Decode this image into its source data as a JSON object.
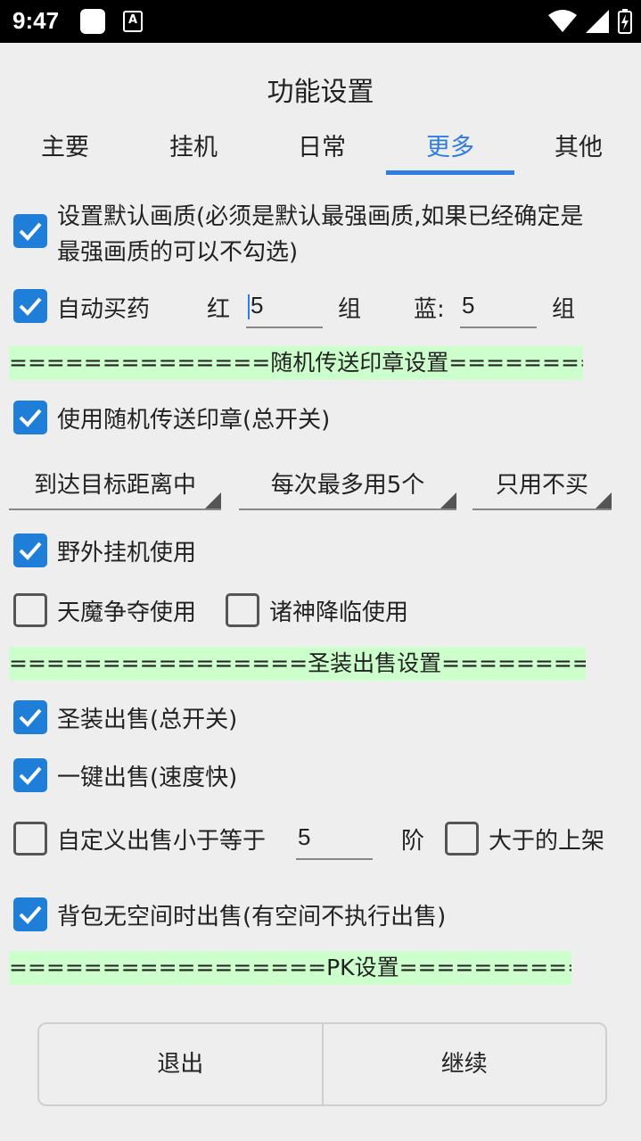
{
  "status_bar": {
    "time": "9:47"
  },
  "title": "功能设置",
  "tabs": [
    {
      "label": "主要"
    },
    {
      "label": "挂机"
    },
    {
      "label": "日常"
    },
    {
      "label": "更多"
    },
    {
      "label": "其他"
    }
  ],
  "active_tab": "更多",
  "default_quality": {
    "label_line1": "设置默认画质(必须是默认最强画质,如果已经确定是",
    "label_line2": "最强画质的可以不勾选)",
    "checked": true
  },
  "auto_buy": {
    "label": "自动买药",
    "red_label": "红",
    "red_value": "5",
    "red_unit": "组",
    "blue_label": "蓝:",
    "blue_value": "5",
    "blue_unit": "组",
    "checked": true
  },
  "banner_seal": "==============随机传送印章设置==============",
  "use_seal": {
    "label": "使用随机传送印章(总开关)",
    "checked": true
  },
  "spinners": {
    "distance": "到达目标距离中",
    "max_use": "每次最多用5个",
    "buy_mode": "只用不买"
  },
  "field_use": {
    "label": "野外挂机使用",
    "checked": true
  },
  "tianmo": {
    "label": "天魔争夺使用",
    "checked": false
  },
  "zhushen": {
    "label": "诸神降临使用",
    "checked": false
  },
  "banner_sale": "================圣装出售设置================",
  "sale_master": {
    "label": "圣装出售(总开关)",
    "checked": true
  },
  "one_key": {
    "label": "一键出售(速度快)",
    "checked": true
  },
  "custom_sale": {
    "label": "自定义出售小于等于",
    "value": "5",
    "unit": "阶",
    "checked": false
  },
  "list_above": {
    "label": "大于的上架",
    "checked": false
  },
  "bag_full": {
    "label": "背包无空间时出售(有空间不执行出售)",
    "checked": true
  },
  "banner_pk": "=================PK设置=================",
  "buttons": {
    "exit": "退出",
    "continue": "继续"
  },
  "colors": {
    "accent": "#2f7de1",
    "checkbox": "#1f7ed8",
    "banner": "#ccffcc",
    "background": "#eeeeee"
  }
}
